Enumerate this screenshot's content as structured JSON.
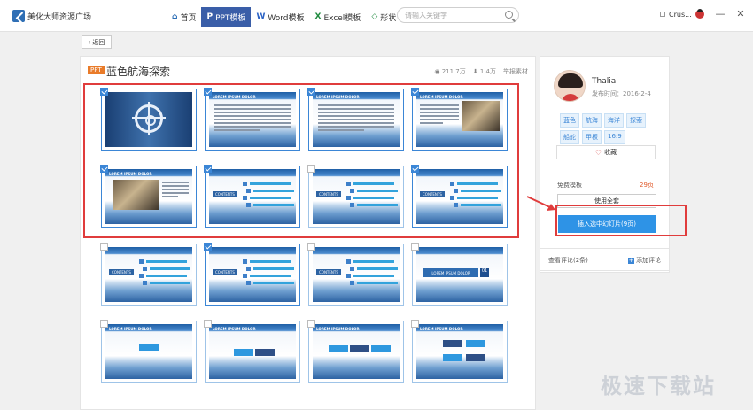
{
  "app": {
    "title": "美化大师资源广场"
  },
  "nav": {
    "tabs": [
      {
        "label": "首页",
        "icon": "home-icon"
      },
      {
        "label": "PPT模板",
        "icon": "ppt-icon",
        "active": true
      },
      {
        "label": "Word模板",
        "icon": "word-icon"
      },
      {
        "label": "Excel模板",
        "icon": "excel-icon"
      },
      {
        "label": "形状",
        "icon": "shape-icon"
      }
    ]
  },
  "search": {
    "placeholder": "请输入关键字"
  },
  "user": {
    "name": "Crus..."
  },
  "window": {
    "minimize": "—",
    "maximize": "☐",
    "close": "✕"
  },
  "back": {
    "label": "返回"
  },
  "template": {
    "badge": "PPT",
    "title": "蓝色航海探索",
    "views": "211.7万",
    "downloads": "1.4万",
    "report": "举报素材"
  },
  "slides": {
    "heading": "LOREM IPSUM DOLOR",
    "contents": "CONTENTS",
    "number": "01",
    "checked": [
      true,
      true,
      true,
      true,
      true,
      true,
      false,
      true,
      false,
      true,
      false,
      false,
      false,
      false,
      false,
      false
    ]
  },
  "sidebar": {
    "author": "Thalia",
    "publish_date": "发布时间：2016-2-4",
    "tags": [
      "蓝色",
      "航海",
      "海洋",
      "探索",
      "船舵",
      "甲板",
      "16:9"
    ],
    "favorite": "收藏",
    "free_label": "免费模板",
    "free_count": "29页",
    "use_all": "使用全套",
    "insert_selected": "插入选中幻灯片(9页)"
  },
  "comments": {
    "view": "查看评论(2条)",
    "add": "添加评论"
  },
  "watermark": "极速下载站",
  "colors": {
    "accent": "#3a5ea8",
    "highlight": "#e03c3c",
    "primary_button": "#2e93e6"
  }
}
